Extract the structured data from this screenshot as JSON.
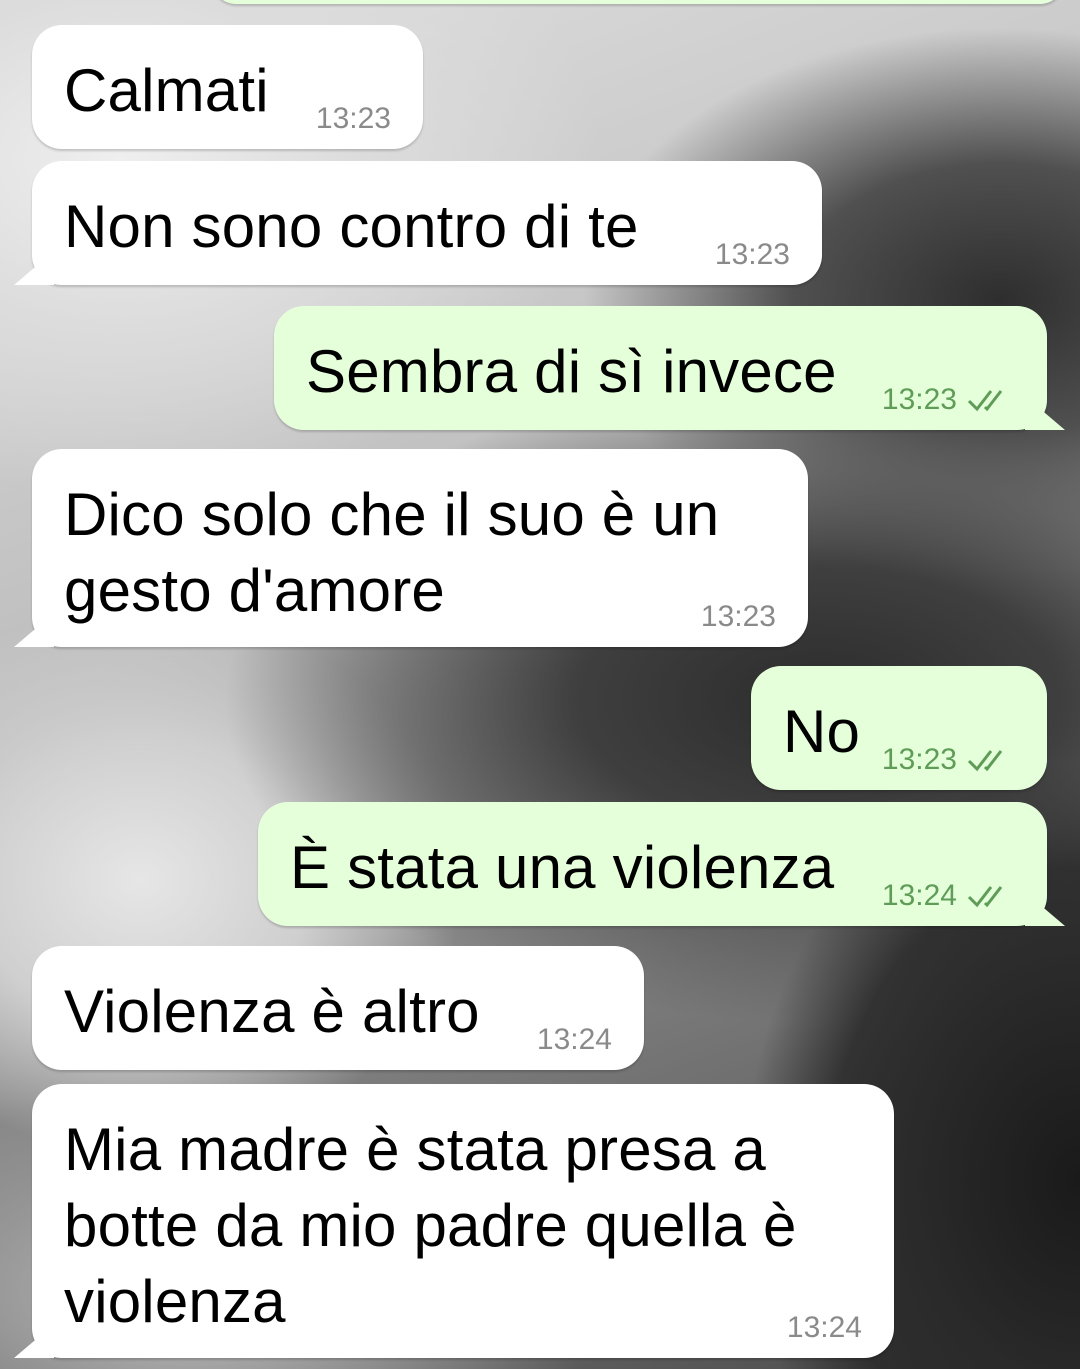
{
  "chat": {
    "messages": [
      {
        "direction": "in",
        "text": "Calmati",
        "time": "13:23"
      },
      {
        "direction": "in",
        "text": "Non sono contro di te",
        "time": "13:23"
      },
      {
        "direction": "out",
        "text": "Sembra di sì invece",
        "time": "13:23",
        "status": "read"
      },
      {
        "direction": "in",
        "text": "Dico solo che il suo è un\ngesto d'amore",
        "time": "13:23"
      },
      {
        "direction": "out",
        "text": "No",
        "time": "13:23",
        "status": "read"
      },
      {
        "direction": "out",
        "text": "È stata una violenza",
        "time": "13:24",
        "status": "read"
      },
      {
        "direction": "in",
        "text": "Violenza è altro",
        "time": "13:24"
      },
      {
        "direction": "in",
        "text": "Mia madre è stata presa a\nbotte da mio padre quella è\nviolenza",
        "time": "13:24"
      }
    ]
  },
  "colors": {
    "incoming_bubble": "#ffffff",
    "outgoing_bubble": "#e6ffdb",
    "read_ticks": "#5e9c58",
    "timestamp_in": "#8a8a8a"
  },
  "icons": {
    "read_receipt": "double-check-icon"
  }
}
